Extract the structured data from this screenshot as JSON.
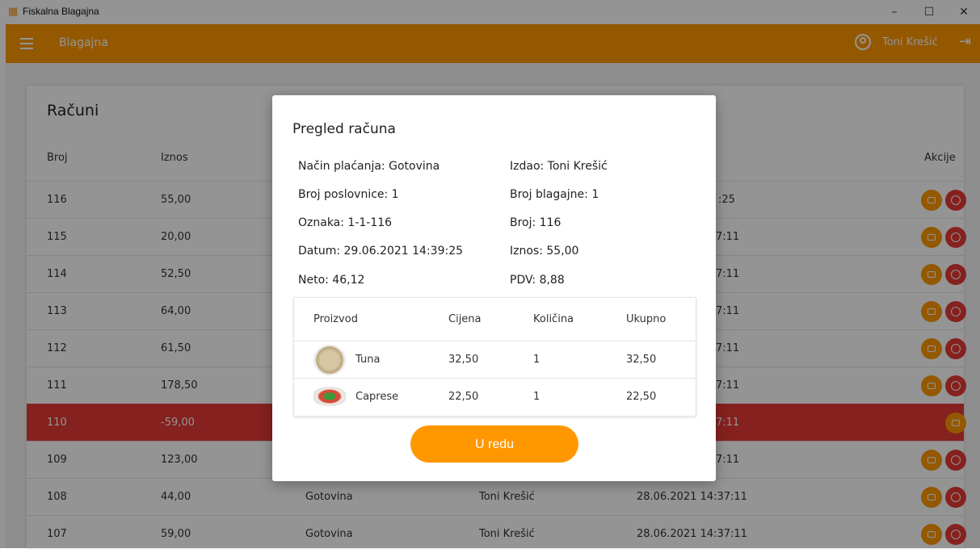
{
  "window": {
    "title": "Fiskalna Blagajna",
    "app_icon": "cash-register-icon",
    "controls": [
      "–",
      "☐",
      "✕"
    ]
  },
  "header": {
    "title": "Blagajna",
    "user_name": "Toni Krešić"
  },
  "colors": {
    "accent": "#ff9800",
    "danger": "#e53935"
  },
  "list": {
    "title": "Računi",
    "columns": {
      "broj": "Broj",
      "iznos": "Iznos",
      "akcije": "Akcije"
    },
    "rows": [
      {
        "broj": "116",
        "iznos": "55,00",
        "nacin": "",
        "izdao": "",
        "datum": ":25",
        "negative": false
      },
      {
        "broj": "115",
        "iznos": "20,00",
        "nacin": "",
        "izdao": "",
        "datum": "7:11",
        "negative": false
      },
      {
        "broj": "114",
        "iznos": "52,50",
        "nacin": "",
        "izdao": "",
        "datum": "7:11",
        "negative": false
      },
      {
        "broj": "113",
        "iznos": "64,00",
        "nacin": "",
        "izdao": "",
        "datum": "7:11",
        "negative": false
      },
      {
        "broj": "112",
        "iznos": "61,50",
        "nacin": "",
        "izdao": "",
        "datum": "7:11",
        "negative": false
      },
      {
        "broj": "111",
        "iznos": "178,50",
        "nacin": "",
        "izdao": "",
        "datum": "7:11",
        "negative": false
      },
      {
        "broj": "110",
        "iznos": "-59,00",
        "nacin": "",
        "izdao": "",
        "datum": "7:11",
        "negative": true
      },
      {
        "broj": "109",
        "iznos": "123,00",
        "nacin": "",
        "izdao": "",
        "datum": "7:11",
        "negative": false
      },
      {
        "broj": "108",
        "iznos": "44,00",
        "nacin": "Gotovina",
        "izdao": "Toni Krešić",
        "datum": "28.06.2021 14:37:11",
        "negative": false
      },
      {
        "broj": "107",
        "iznos": "59,00",
        "nacin": "Gotovina",
        "izdao": "Toni Krešić",
        "datum": "28.06.2021 14:37:11",
        "negative": false
      }
    ]
  },
  "dialog": {
    "title": "Pregled računa",
    "nacin_placanja": "Način plaćanja: Gotovina",
    "izdao": "Izdao: Toni Krešić",
    "broj_poslovnice": "Broj poslovnice: 1",
    "broj_blagajne": "Broj blagajne: 1",
    "oznaka": "Oznaka: 1-1-116",
    "broj": "Broj: 116",
    "datum": "Datum: 29.06.2021 14:39:25",
    "iznos": "Iznos: 55,00",
    "neto": "Neto: 46,12",
    "pdv": "PDV: 8,88",
    "items_header": {
      "proizvod": "Proizvod",
      "cijena": "Cijena",
      "kolicina": "Količina",
      "ukupno": "Ukupno"
    },
    "items": [
      {
        "name": "Tuna",
        "cijena": "32,50",
        "kolicina": "1",
        "ukupno": "32,50",
        "image": "tuna-salad-image"
      },
      {
        "name": "Caprese",
        "cijena": "22,50",
        "kolicina": "1",
        "ukupno": "22,50",
        "image": "caprese-salad-image"
      }
    ],
    "ok_label": "U redu"
  }
}
